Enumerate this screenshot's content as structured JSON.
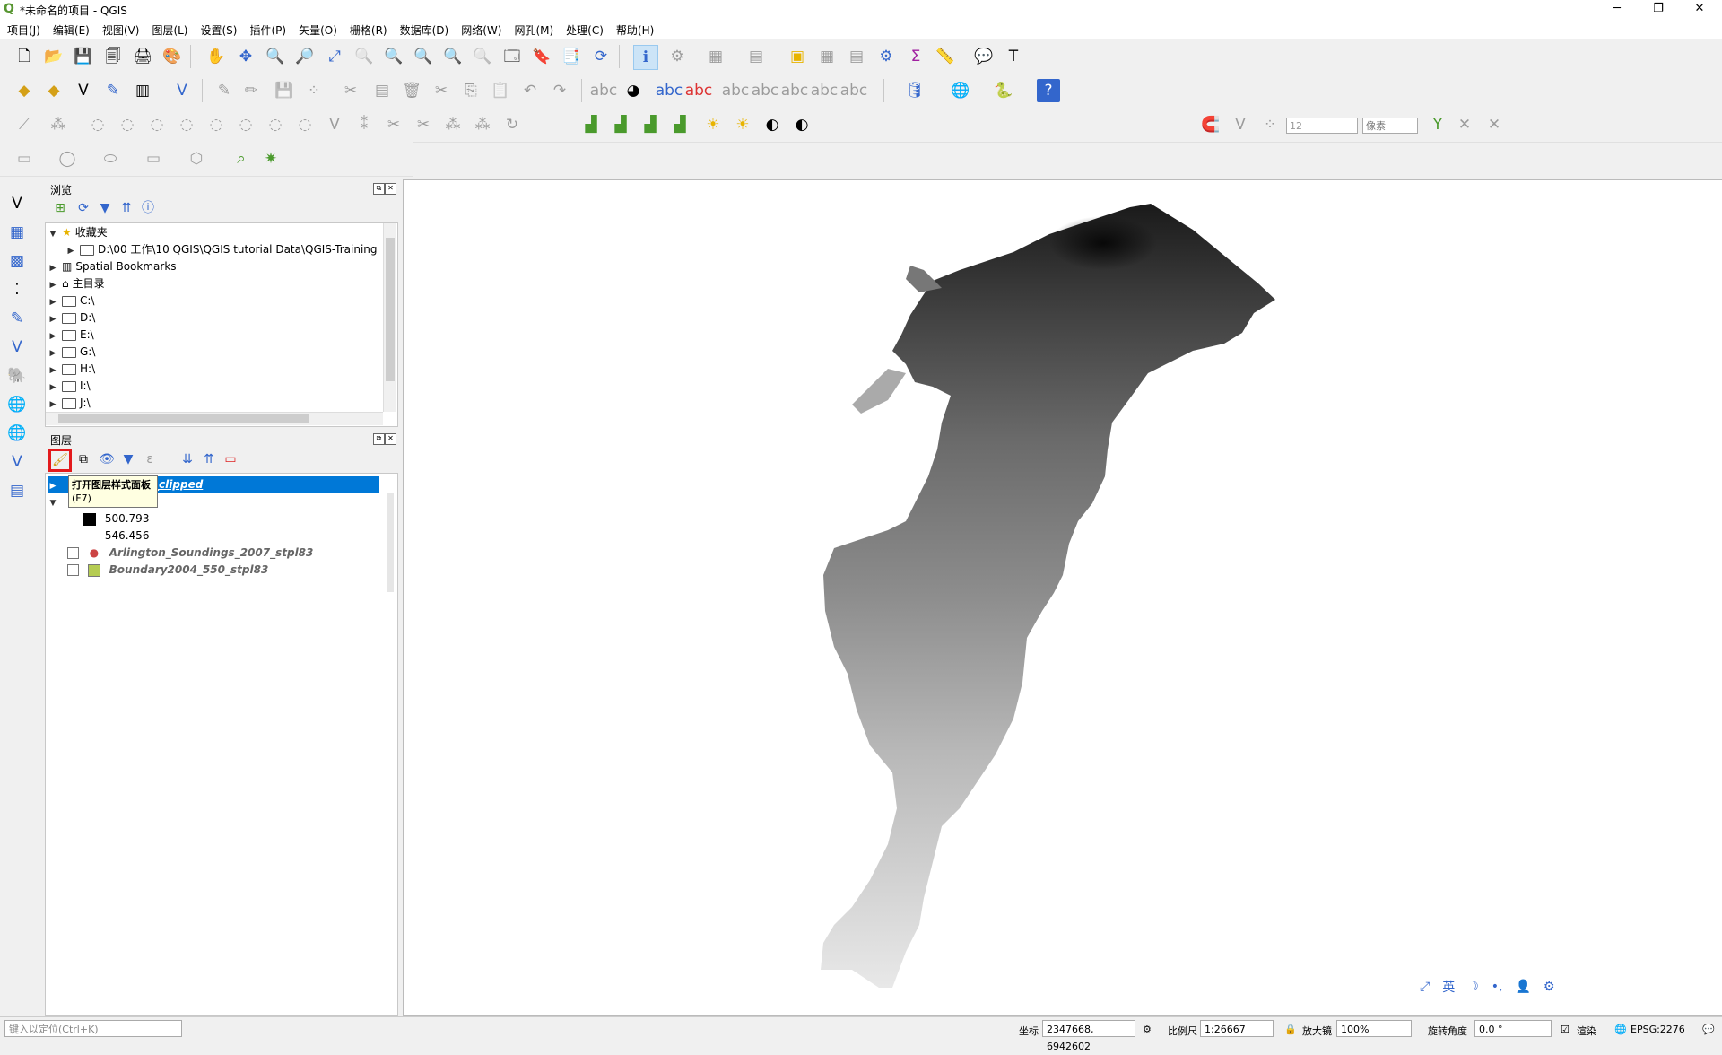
{
  "window": {
    "title": "*未命名的项目 - QGIS",
    "minimize": "─",
    "maximize": "❐",
    "close": "✕"
  },
  "menu": [
    "项目(J)",
    "编辑(E)",
    "视图(V)",
    "图层(L)",
    "设置(S)",
    "插件(P)",
    "矢量(O)",
    "栅格(R)",
    "数据库(D)",
    "网络(W)",
    "网孔(M)",
    "处理(C)",
    "帮助(H)"
  ],
  "snapping": {
    "tolerance_value": "12",
    "tolerance_unit": "像素"
  },
  "browser_panel": {
    "title": "浏览",
    "items": [
      {
        "label": "收藏夹",
        "icon": "star-icon",
        "expanded": true
      },
      {
        "label": "D:\\00 工作\\10 QGIS\\QGIS tutorial Data\\QGIS-Training",
        "icon": "folder-icon"
      },
      {
        "label": "Spatial Bookmarks",
        "icon": "bookmark-icon"
      },
      {
        "label": "主目录",
        "icon": "home-icon"
      },
      {
        "label": "C:\\",
        "icon": "folder-icon"
      },
      {
        "label": "D:\\",
        "icon": "folder-icon"
      },
      {
        "label": "E:\\",
        "icon": "folder-icon"
      },
      {
        "label": "G:\\",
        "icon": "folder-icon"
      },
      {
        "label": "H:\\",
        "icon": "folder-icon"
      },
      {
        "label": "I:\\",
        "icon": "folder-icon"
      },
      {
        "label": "J:\\",
        "icon": "folder-icon"
      }
    ]
  },
  "layers_panel": {
    "title": "图层",
    "layers": [
      {
        "label": "tin_clipped",
        "selected": true
      },
      {
        "label": "tin",
        "italic": true
      },
      {
        "label": "500.793",
        "legend": true,
        "swatch": "#000000"
      },
      {
        "label": "546.456",
        "legend": true,
        "swatch": "#ffffff"
      },
      {
        "label": "Arlington_Soundings_2007_stpl83",
        "italic": true
      },
      {
        "label": "Boundary2004_550_stpl83",
        "italic": true
      }
    ],
    "tooltip": {
      "line1": "打开图层样式面板",
      "line2": "(F7)"
    }
  },
  "statusbar": {
    "locator_placeholder": "键入以定位(Ctrl+K)",
    "coord_label": "坐标",
    "coord_value": "2347668, 6942602",
    "scale_label": "比例尺",
    "scale_value": "1:26667",
    "magnifier_label": "放大镜",
    "magnifier_value": "100%",
    "rotation_label": "旋转角度",
    "rotation_value": "0.0 °",
    "render_label": "渲染",
    "crs": "EPSG:2276"
  },
  "colors": {
    "selection": "#0078d7",
    "highlight_box": "#e31a1c",
    "qgis_green": "#589632"
  },
  "map_float_icons": [
    "英"
  ]
}
